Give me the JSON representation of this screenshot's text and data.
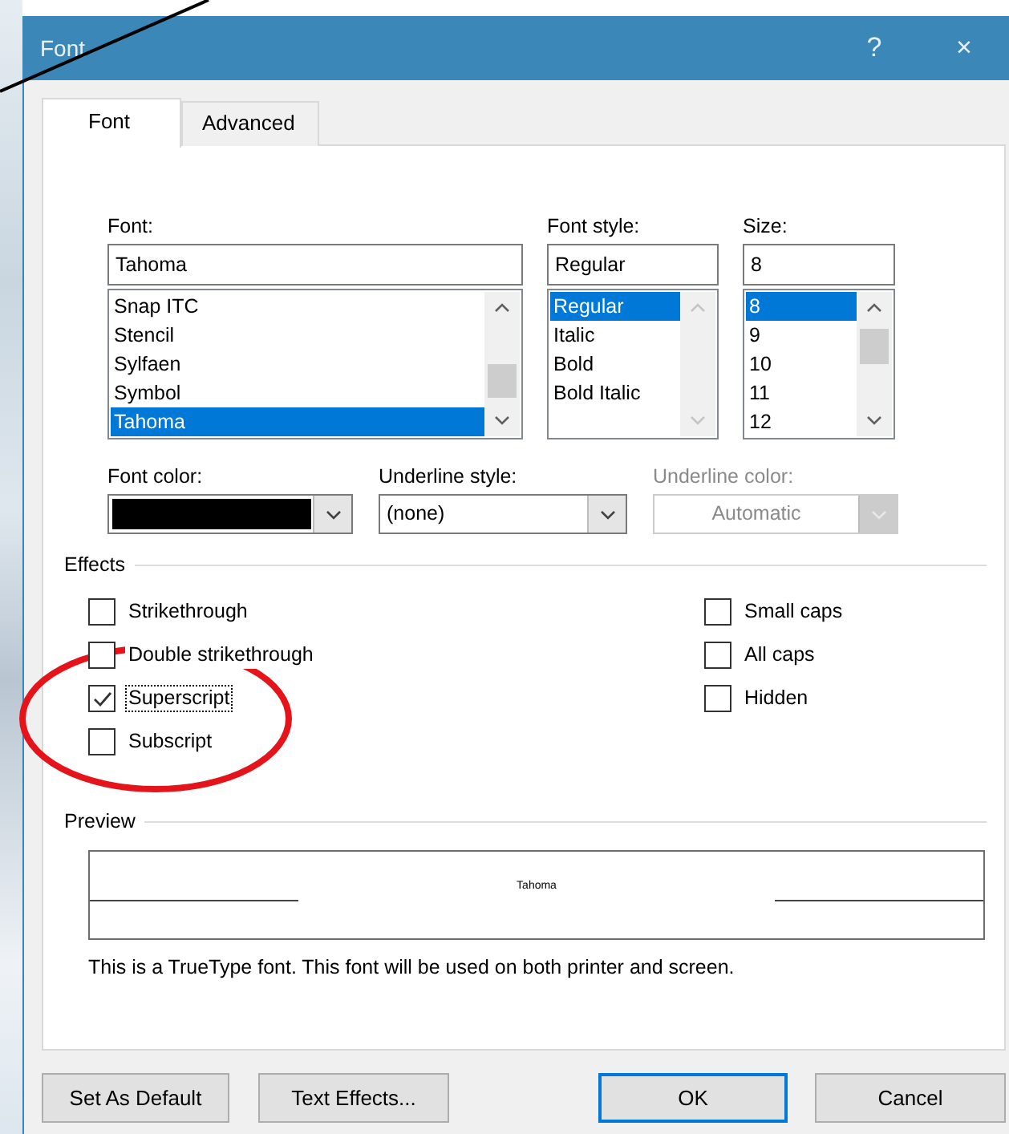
{
  "window": {
    "title": "Font",
    "help": "?",
    "close": "×"
  },
  "tabs": [
    {
      "label": "Font",
      "selected": true
    },
    {
      "label": "Advanced",
      "selected": false
    }
  ],
  "font": {
    "label": "Font:",
    "value": "Tahoma",
    "items": [
      {
        "text": "Snap ITC",
        "selected": false
      },
      {
        "text": "Stencil",
        "selected": false
      },
      {
        "text": "Sylfaen",
        "selected": false
      },
      {
        "text": "Symbol",
        "selected": false
      },
      {
        "text": "Tahoma",
        "selected": true
      }
    ]
  },
  "font_style": {
    "label": "Font style:",
    "value": "Regular",
    "items": [
      {
        "text": "Regular",
        "selected": true
      },
      {
        "text": "Italic",
        "selected": false
      },
      {
        "text": "Bold",
        "selected": false
      },
      {
        "text": "Bold Italic",
        "selected": false
      }
    ]
  },
  "size": {
    "label": "Size:",
    "value": "8",
    "items": [
      {
        "text": "8",
        "selected": true
      },
      {
        "text": "9",
        "selected": false
      },
      {
        "text": "10",
        "selected": false
      },
      {
        "text": "11",
        "selected": false
      },
      {
        "text": "12",
        "selected": false
      }
    ]
  },
  "font_color": {
    "label": "Font color:",
    "color": "#000000"
  },
  "underline_style": {
    "label": "Underline style:",
    "value": "(none)"
  },
  "underline_color": {
    "label": "Underline color:",
    "value": "Automatic",
    "disabled": true
  },
  "effects": {
    "title": "Effects",
    "left": [
      {
        "label": "Strikethrough",
        "checked": false,
        "focused": false
      },
      {
        "label": "Double strikethrough",
        "checked": false,
        "focused": false
      },
      {
        "label": "Superscript",
        "checked": true,
        "focused": true
      },
      {
        "label": "Subscript",
        "checked": false,
        "focused": false
      }
    ],
    "right": [
      {
        "label": "Small caps",
        "checked": false,
        "focused": false
      },
      {
        "label": "All caps",
        "checked": false,
        "focused": false
      },
      {
        "label": "Hidden",
        "checked": false,
        "focused": false
      }
    ]
  },
  "preview": {
    "title": "Preview",
    "sample": "Tahoma"
  },
  "description": "This is a TrueType font. This font will be used on both printer and screen.",
  "buttons": [
    {
      "label": "Set As Default",
      "default": false
    },
    {
      "label": "Text Effects...",
      "default": false
    },
    {
      "label": "OK",
      "default": true
    },
    {
      "label": "Cancel",
      "default": false
    }
  ]
}
